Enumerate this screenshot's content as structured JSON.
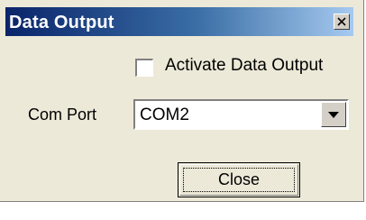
{
  "window": {
    "title": "Data Output",
    "close_glyph": "×"
  },
  "activate": {
    "label": "Activate Data Output",
    "checked": false
  },
  "com_port": {
    "label": "Com Port",
    "selected": "COM2"
  },
  "buttons": {
    "close_label": "Close"
  },
  "colors": {
    "title_gradient_start": "#0a246a",
    "title_gradient_end": "#a6caf0",
    "dialog_background": "#ece9d8"
  },
  "icons": {
    "title_close": "close-icon",
    "dropdown": "chevron-down-icon"
  }
}
